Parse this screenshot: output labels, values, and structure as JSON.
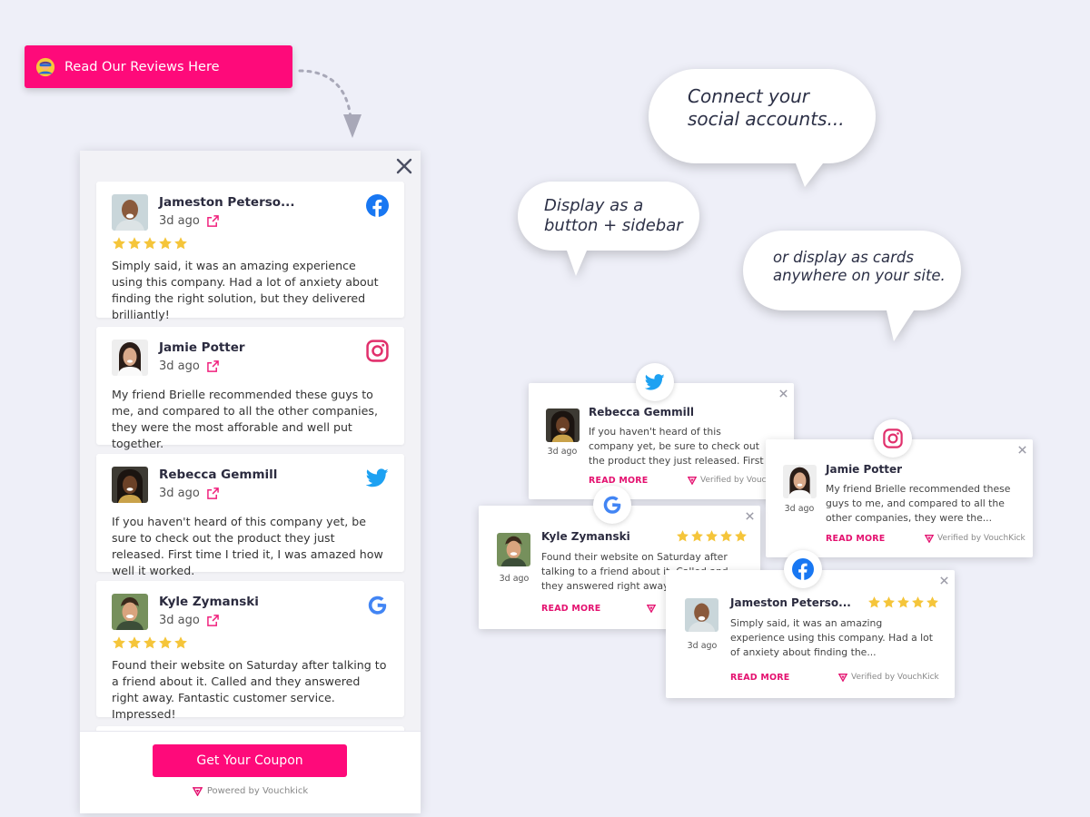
{
  "launcher": {
    "label": "Read Our Reviews Here",
    "icon": "reviewer-icon"
  },
  "sidebar": {
    "reviews": [
      {
        "name": "Jameston Peterso...",
        "date": "3d ago",
        "network": "facebook",
        "stars": 5,
        "text": "Simply said, it was an amazing experience using this company. Had a lot of anxiety about finding the right solution, but they delivered brilliantly!"
      },
      {
        "name": "Jamie Potter",
        "date": "3d ago",
        "network": "instagram",
        "stars": 0,
        "text": "My friend Brielle recommended these guys to me, and compared to all the other companies, they were the most afforable and well put together."
      },
      {
        "name": "Rebecca Gemmill",
        "date": "3d ago",
        "network": "twitter",
        "stars": 0,
        "text": "If you haven't heard of this company yet, be sure to check out the product they just released. First time I tried it, I was amazed how well it worked."
      },
      {
        "name": "Kyle Zymanski",
        "date": "3d ago",
        "network": "google",
        "stars": 5,
        "text": "Found their website on Saturday after talking to a friend about it. Called and they answered right away. Fantastic customer service. Impressed!"
      }
    ],
    "coupon_label": "Get Your Coupon",
    "powered_by": "Powered by Vouchkick"
  },
  "bubbles": {
    "connect": "Connect your social accounts...",
    "connect_l1": "Connect your",
    "connect_l2": "social accounts...",
    "display_l1": "Display as a",
    "display_l2": "button + sidebar",
    "cards_l1": "or display as cards",
    "cards_l2": "anywhere on your site."
  },
  "cards": {
    "read_more": "READ MORE",
    "verified": "Verified by VouchKick",
    "verified_trunc": "Verified by Vouch",
    "rebecca": {
      "name": "Rebecca Gemmill",
      "date": "3d ago",
      "text": "If you haven't heard of this company yet, be sure to check out the product they just released. First time I tried it..."
    },
    "jamie": {
      "name": "Jamie Potter",
      "date": "3d ago",
      "text": "My friend Brielle recommended these guys to me, and compared to all the other companies, they were the..."
    },
    "kyle": {
      "name": "Kyle Zymanski",
      "date": "3d ago",
      "text": "Found their website on Saturday after talking to a friend about it. Called and they answered right away..."
    },
    "jameston": {
      "name": "Jameston Peterso...",
      "date": "3d ago",
      "text": "Simply said, it was an amazing experience using this company. Had a lot of anxiety about finding the..."
    }
  },
  "colors": {
    "brand_pink": "#fe0a7a",
    "star": "#f5c53a",
    "facebook": "#1877f2",
    "instagram": "#e1306c",
    "twitter": "#1da1f2",
    "google": "#4285f4"
  }
}
